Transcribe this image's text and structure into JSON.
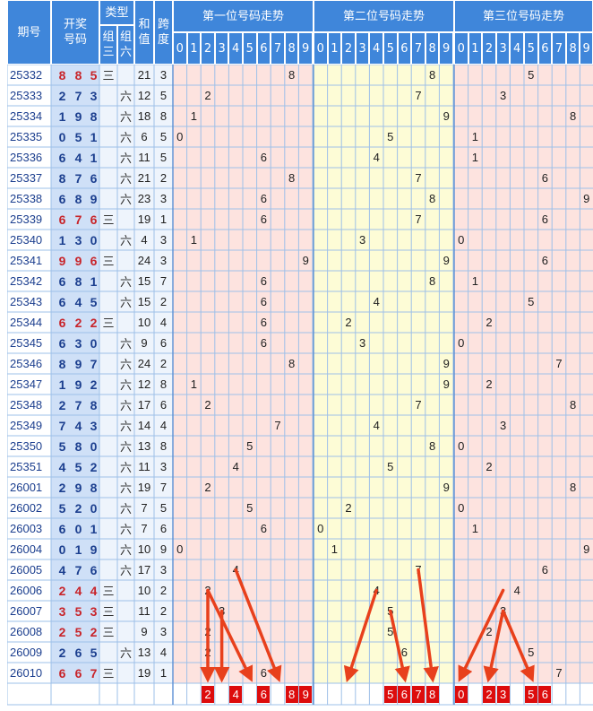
{
  "header": {
    "period_label": "期号",
    "draw_label": "开奖\n号码",
    "type_label": "类型",
    "group3_label": "组\n三",
    "group6_label": "组\n六",
    "sum_label": "和\n值",
    "span_label": "跨\n度",
    "sections": [
      "第一位号码走势",
      "第二位号码走势",
      "第三位号码走势"
    ],
    "digits": [
      "0",
      "1",
      "2",
      "3",
      "4",
      "5",
      "6",
      "7",
      "8",
      "9"
    ]
  },
  "colors": {
    "header_bg": "#3f86da",
    "sec1_bg": "#fde3df",
    "sec2_bg": "#fdfcd6",
    "sec3_bg": "#fde3df",
    "draw_col_bg": "#cfe0f7",
    "type_col_bg": "#eef4fc",
    "forecast_box": "#dd0c0c",
    "arrow": "#e8401c",
    "repeat_digit": "#c8242a",
    "normal_digit": "#1c3f8f"
  },
  "chart_data": {
    "type": "table",
    "columns": [
      "期号",
      "开奖号码",
      "组三",
      "组六",
      "和值",
      "跨度"
    ],
    "rows": [
      {
        "period": "25332",
        "draw": [
          "8",
          "8",
          "5"
        ],
        "type": "三",
        "sum": "21",
        "span": "3"
      },
      {
        "period": "25333",
        "draw": [
          "2",
          "7",
          "3"
        ],
        "type": "六",
        "sum": "12",
        "span": "5"
      },
      {
        "period": "25334",
        "draw": [
          "1",
          "9",
          "8"
        ],
        "type": "六",
        "sum": "18",
        "span": "8"
      },
      {
        "period": "25335",
        "draw": [
          "0",
          "5",
          "1"
        ],
        "type": "六",
        "sum": "6",
        "span": "5"
      },
      {
        "period": "25336",
        "draw": [
          "6",
          "4",
          "1"
        ],
        "type": "六",
        "sum": "11",
        "span": "5"
      },
      {
        "period": "25337",
        "draw": [
          "8",
          "7",
          "6"
        ],
        "type": "六",
        "sum": "21",
        "span": "2"
      },
      {
        "period": "25338",
        "draw": [
          "6",
          "8",
          "9"
        ],
        "type": "六",
        "sum": "23",
        "span": "3"
      },
      {
        "period": "25339",
        "draw": [
          "6",
          "7",
          "6"
        ],
        "type": "三",
        "sum": "19",
        "span": "1"
      },
      {
        "period": "25340",
        "draw": [
          "1",
          "3",
          "0"
        ],
        "type": "六",
        "sum": "4",
        "span": "3"
      },
      {
        "period": "25341",
        "draw": [
          "9",
          "9",
          "6"
        ],
        "type": "三",
        "sum": "24",
        "span": "3"
      },
      {
        "period": "25342",
        "draw": [
          "6",
          "8",
          "1"
        ],
        "type": "六",
        "sum": "15",
        "span": "7"
      },
      {
        "period": "25343",
        "draw": [
          "6",
          "4",
          "5"
        ],
        "type": "六",
        "sum": "15",
        "span": "2"
      },
      {
        "period": "25344",
        "draw": [
          "6",
          "2",
          "2"
        ],
        "type": "三",
        "sum": "10",
        "span": "4"
      },
      {
        "period": "25345",
        "draw": [
          "6",
          "3",
          "0"
        ],
        "type": "六",
        "sum": "9",
        "span": "6"
      },
      {
        "period": "25346",
        "draw": [
          "8",
          "9",
          "7"
        ],
        "type": "六",
        "sum": "24",
        "span": "2"
      },
      {
        "period": "25347",
        "draw": [
          "1",
          "9",
          "2"
        ],
        "type": "六",
        "sum": "12",
        "span": "8"
      },
      {
        "period": "25348",
        "draw": [
          "2",
          "7",
          "8"
        ],
        "type": "六",
        "sum": "17",
        "span": "6"
      },
      {
        "period": "25349",
        "draw": [
          "7",
          "4",
          "3"
        ],
        "type": "六",
        "sum": "14",
        "span": "4"
      },
      {
        "period": "25350",
        "draw": [
          "5",
          "8",
          "0"
        ],
        "type": "六",
        "sum": "13",
        "span": "8"
      },
      {
        "period": "25351",
        "draw": [
          "4",
          "5",
          "2"
        ],
        "type": "六",
        "sum": "11",
        "span": "3"
      },
      {
        "period": "26001",
        "draw": [
          "2",
          "9",
          "8"
        ],
        "type": "六",
        "sum": "19",
        "span": "7"
      },
      {
        "period": "26002",
        "draw": [
          "5",
          "2",
          "0"
        ],
        "type": "六",
        "sum": "7",
        "span": "5"
      },
      {
        "period": "26003",
        "draw": [
          "6",
          "0",
          "1"
        ],
        "type": "六",
        "sum": "7",
        "span": "6"
      },
      {
        "period": "26004",
        "draw": [
          "0",
          "1",
          "9"
        ],
        "type": "六",
        "sum": "10",
        "span": "9"
      },
      {
        "period": "26005",
        "draw": [
          "4",
          "7",
          "6"
        ],
        "type": "六",
        "sum": "17",
        "span": "3"
      },
      {
        "period": "26006",
        "draw": [
          "2",
          "4",
          "4"
        ],
        "type": "三",
        "sum": "10",
        "span": "2"
      },
      {
        "period": "26007",
        "draw": [
          "3",
          "5",
          "3"
        ],
        "type": "三",
        "sum": "11",
        "span": "2"
      },
      {
        "period": "26008",
        "draw": [
          "2",
          "5",
          "2"
        ],
        "type": "三",
        "sum": "9",
        "span": "3"
      },
      {
        "period": "26009",
        "draw": [
          "2",
          "6",
          "5"
        ],
        "type": "六",
        "sum": "13",
        "span": "4"
      },
      {
        "period": "26010",
        "draw": [
          "6",
          "6",
          "7"
        ],
        "type": "三",
        "sum": "19",
        "span": "1"
      }
    ],
    "forecast": [
      [
        "2",
        "4",
        "6",
        "8",
        "9"
      ],
      [
        "5",
        "6",
        "7",
        "8"
      ],
      [
        "0",
        "2",
        "3",
        "5",
        "6"
      ]
    ],
    "arrows": [
      {
        "section": 0,
        "from": {
          "row": 25,
          "digit": 2
        },
        "to": {
          "row": 29,
          "digit": 2
        }
      },
      {
        "section": 0,
        "from": {
          "row": 26,
          "digit": 3
        },
        "to": {
          "row": 29,
          "digit": 3
        }
      },
      {
        "section": 0,
        "from": {
          "row": 25,
          "digit": 2
        },
        "to": {
          "row": 29,
          "digit": 5
        }
      },
      {
        "section": 0,
        "from": {
          "row": 24,
          "digit": 4
        },
        "to": {
          "row": 29,
          "digit": 7
        }
      },
      {
        "section": 1,
        "from": {
          "row": 25,
          "digit": 4
        },
        "to": {
          "row": 29,
          "digit": 2
        }
      },
      {
        "section": 1,
        "from": {
          "row": 26,
          "digit": 5
        },
        "to": {
          "row": 29,
          "digit": 6
        }
      },
      {
        "section": 1,
        "from": {
          "row": 24,
          "digit": 7
        },
        "to": {
          "row": 29,
          "digit": 8
        }
      },
      {
        "section": 2,
        "from": {
          "row": 25,
          "digit": 3
        },
        "to": {
          "row": 29,
          "digit": 0
        }
      },
      {
        "section": 2,
        "from": {
          "row": 26,
          "digit": 3
        },
        "to": {
          "row": 29,
          "digit": 2
        }
      },
      {
        "section": 2,
        "from": {
          "row": 26,
          "digit": 3
        },
        "to": {
          "row": 29,
          "digit": 5
        }
      }
    ]
  }
}
